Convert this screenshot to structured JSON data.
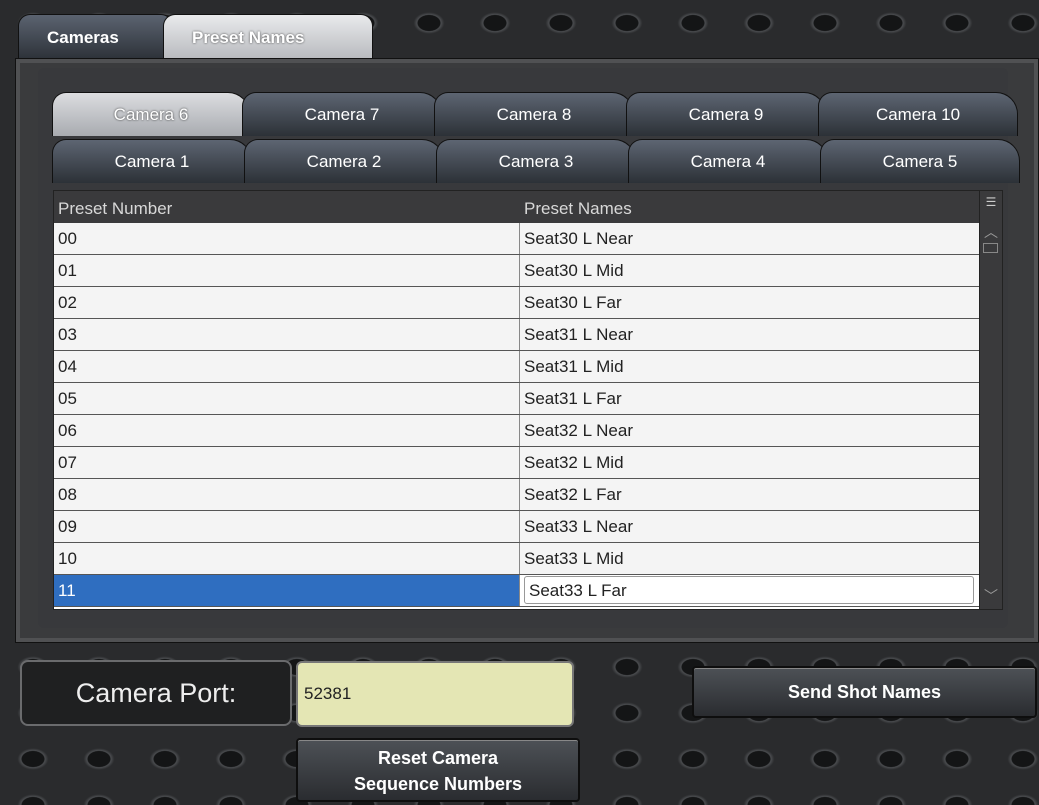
{
  "top_tabs": [
    {
      "label": "Cameras",
      "active": false
    },
    {
      "label": "Preset Names",
      "active": true
    }
  ],
  "camera_tabs_row1": [
    "Camera 6",
    "Camera 7",
    "Camera 8",
    "Camera 9",
    "Camera 10"
  ],
  "camera_tabs_row2": [
    "Camera 1",
    "Camera 2",
    "Camera 3",
    "Camera 4",
    "Camera 5"
  ],
  "selected_camera": "Camera 6",
  "table": {
    "headers": [
      "Preset Number",
      "Preset Names"
    ],
    "rows": [
      {
        "num": "00",
        "name": "Seat30 L Near"
      },
      {
        "num": "01",
        "name": "Seat30 L Mid"
      },
      {
        "num": "02",
        "name": "Seat30 L Far"
      },
      {
        "num": "03",
        "name": "Seat31 L Near"
      },
      {
        "num": "04",
        "name": "Seat31 L Mid"
      },
      {
        "num": "05",
        "name": "Seat31 L Far"
      },
      {
        "num": "06",
        "name": "Seat32 L Near"
      },
      {
        "num": "07",
        "name": "Seat32 L Mid"
      },
      {
        "num": "08",
        "name": "Seat32 L Far"
      },
      {
        "num": "09",
        "name": "Seat33 L Near"
      },
      {
        "num": "10",
        "name": "Seat33 L Mid"
      },
      {
        "num": "11",
        "name": "Seat33 L Far"
      }
    ],
    "selected_row": "11"
  },
  "camera_port": {
    "label": "Camera Port:",
    "value": "52381"
  },
  "buttons": {
    "send": "Send Shot Names",
    "reset_line1": "Reset Camera",
    "reset_line2": "Sequence Numbers"
  },
  "colors": {
    "selection": "#2f6ec0",
    "port_field": "#e4e6b4"
  }
}
